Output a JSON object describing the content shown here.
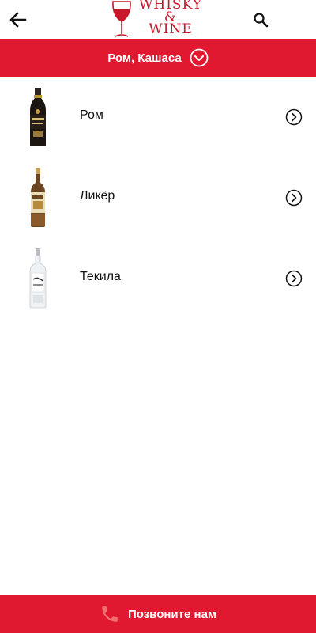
{
  "header": {
    "logo_line1": "WHISKY",
    "logo_line2": "&",
    "logo_line3": "WINE",
    "back_icon": "arrow-left-icon",
    "search_icon": "search-icon"
  },
  "category": {
    "label": "Ром, Кашаса",
    "icon": "chevron-down-circle-icon"
  },
  "items": [
    {
      "label": "Ром",
      "thumb": "rum-bottle-image"
    },
    {
      "label": "Ликёр",
      "thumb": "liqueur-bottle-image"
    },
    {
      "label": "Текила",
      "thumb": "tequila-bottle-image"
    }
  ],
  "footer": {
    "label": "Позвоните нам",
    "icon": "phone-icon"
  },
  "colors": {
    "accent": "#e01830",
    "logo": "#c8182c"
  }
}
